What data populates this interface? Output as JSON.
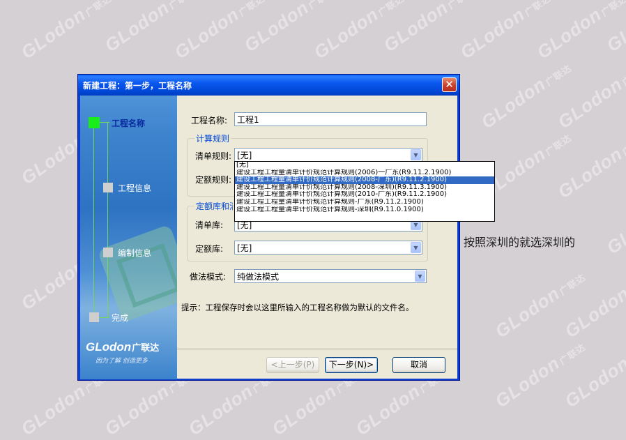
{
  "watermark": {
    "brand": "GLodon",
    "cn": "广联达"
  },
  "dialog": {
    "title": "新建工程：第一步，工程名称",
    "close_glyph": "✕"
  },
  "steps": [
    {
      "label": "工程名称",
      "active": true
    },
    {
      "label": "工程信息",
      "active": false
    },
    {
      "label": "编制信息",
      "active": false
    },
    {
      "label": "完成",
      "active": false
    }
  ],
  "logo": {
    "brand": "GLodon",
    "cn": "广联达",
    "slogan": "因为了解 创造更多"
  },
  "form": {
    "project_name_label": "工程名称:",
    "project_name_value": "工程1",
    "calc_rules_group": "计算规则",
    "list_rule_label": "清单规则:",
    "list_rule_value": "[无]",
    "quota_rule_label": "定额规则:",
    "lib_group": "定额库和清单库",
    "list_lib_label": "清单库:",
    "list_lib_value": "[无]",
    "quota_lib_label": "定额库:",
    "quota_lib_value": "[无]",
    "mode_label": "做法模式:",
    "mode_value": "纯做法模式",
    "hint": "提示：工程保存时会以这里所输入的工程名称做为默认的文件名。"
  },
  "dropdown": {
    "selected_index": 2,
    "options": [
      "[无]",
      "建设工程工程量清单计价规范计算规则(2006)一广东(R9.11.2.1900)",
      "建设工程工程量清单计价规范计算规则(2008-广东)(R9.11.2.1900)",
      "建设工程工程量清单计价规范计算规则(2008-深圳)(R9.11.3.1900)",
      "建设工程工程量清单计价规范计算规则(2010-广东)(R9.11.2.1900)",
      "建设工程工程量清单计价规范计算规则-广东(R9.11.2.1900)",
      "建设工程工程量清单计价规范计算规则-深圳(R9.11.0.1900)"
    ]
  },
  "buttons": {
    "prev": "<上一步(P)",
    "next": "下一步(N)>",
    "cancel": "取消"
  },
  "annotation": "按照深圳的就选深圳的",
  "colors": {
    "title_bar": "#0a58ee",
    "accent": "#0046d5",
    "selected": "#316ac5",
    "step_active": "#1aee1a"
  }
}
